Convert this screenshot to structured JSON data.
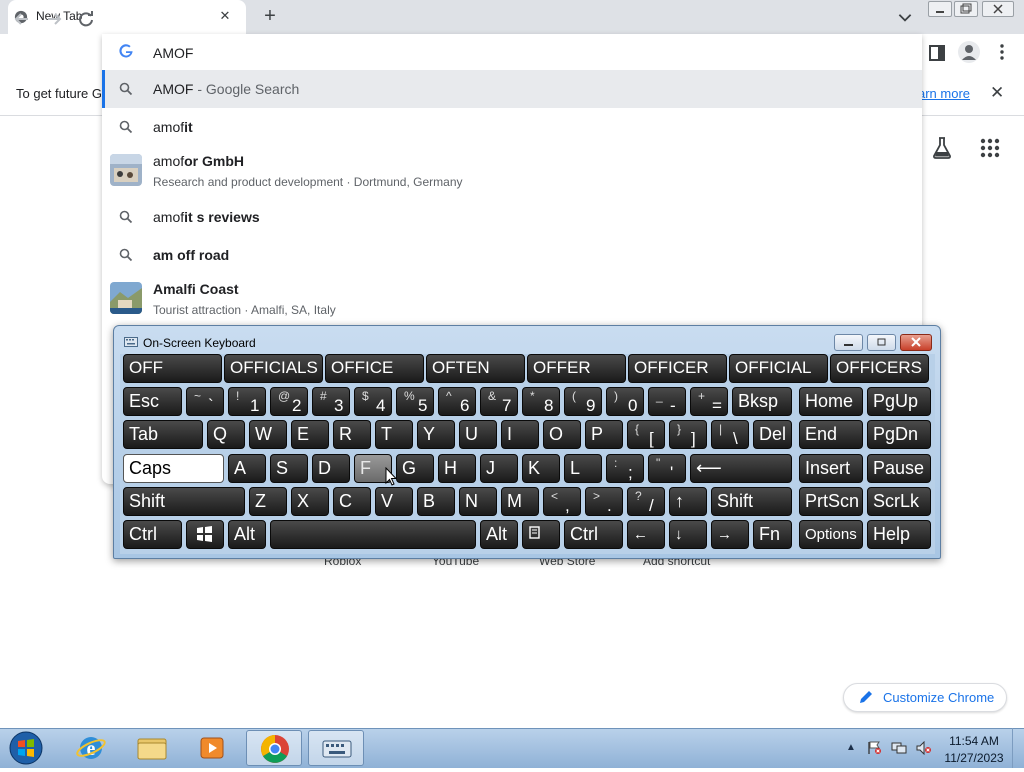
{
  "browser": {
    "tab_title": "New Tab",
    "tab_close_glyph": "✕",
    "new_tab_glyph": "+",
    "omnibox_value": "AMOF",
    "infobar_text": "To get future G",
    "infobar_link": "arn more",
    "infobar_close": "✕"
  },
  "suggestions": [
    {
      "type": "search",
      "icon": "search-icon",
      "prefix": "AMOF",
      "bold": "",
      "suffix": " - Google Search",
      "selected": true
    },
    {
      "type": "search",
      "icon": "search-icon",
      "prefix": "amof",
      "bold": "it",
      "suffix": "",
      "selected": false
    },
    {
      "type": "entity",
      "icon": "entity-thumbnail",
      "prefix": "amof",
      "bold": "or GmbH",
      "suffix": "",
      "sub": "Research and product development · Dortmund, Germany",
      "selected": false
    },
    {
      "type": "search",
      "icon": "search-icon",
      "prefix": "amof",
      "bold": "it s reviews",
      "suffix": "",
      "selected": false
    },
    {
      "type": "search",
      "icon": "search-icon",
      "prefix": "",
      "bold": "am off road",
      "suffix": "",
      "selected": false
    },
    {
      "type": "entity",
      "icon": "entity-thumbnail",
      "prefix": "",
      "bold": "Amalfi Coast",
      "suffix": "",
      "sub": "Tourist attraction · Amalfi, SA, Italy",
      "selected": false
    }
  ],
  "ntp": {
    "shortcuts": [
      "Roblox",
      "YouTube",
      "Web Store",
      "Add shortcut"
    ],
    "customize_label": "Customize Chrome"
  },
  "osk": {
    "title": "On-Screen Keyboard",
    "prediction_row": [
      "OFF",
      "OFFICIALS",
      "OFFICE",
      "OFTEN",
      "OFFER",
      "OFFICER",
      "OFFICIAL",
      "OFFICERS"
    ],
    "keys": {
      "esc": "Esc",
      "tab": "Tab",
      "caps": "Caps",
      "shift_l": "Shift",
      "shift_r": "Shift",
      "ctrl_l": "Ctrl",
      "ctrl_r": "Ctrl",
      "alt_l": "Alt",
      "alt_r": "Alt",
      "bksp": "Bksp",
      "del": "Del",
      "home": "Home",
      "pgup": "PgUp",
      "end": "End",
      "pgdn": "PgDn",
      "insert": "Insert",
      "pause": "Pause",
      "prtscn": "PrtScn",
      "scrlk": "ScrLk",
      "fn": "Fn",
      "options": "Options",
      "help": "Help",
      "enter": "⟵",
      "up": "↑",
      "left": "←",
      "down": "↓",
      "right": "→",
      "q": "Q",
      "w": "W",
      "e": "E",
      "r": "R",
      "t": "T",
      "y": "Y",
      "u": "U",
      "i": "I",
      "o": "O",
      "p": "P",
      "a": "A",
      "s": "S",
      "d": "D",
      "f": "F",
      "g": "G",
      "h": "H",
      "j": "J",
      "k": "K",
      "l": "L",
      "z": "Z",
      "x": "X",
      "c": "C",
      "v": "V",
      "b": "B",
      "n": "N",
      "m": "M"
    },
    "number_row": [
      {
        "top": "~",
        "bot": "`"
      },
      {
        "top": "!",
        "bot": "1"
      },
      {
        "top": "@",
        "bot": "2"
      },
      {
        "top": "#",
        "bot": "3"
      },
      {
        "top": "$",
        "bot": "4"
      },
      {
        "top": "%",
        "bot": "5"
      },
      {
        "top": "^",
        "bot": "6"
      },
      {
        "top": "&",
        "bot": "7"
      },
      {
        "top": "*",
        "bot": "8"
      },
      {
        "top": "(",
        "bot": "9"
      },
      {
        "top": ")",
        "bot": "0"
      },
      {
        "top": "_",
        "bot": "-"
      },
      {
        "top": "+",
        "bot": "="
      }
    ],
    "punct": {
      "lbrace": {
        "top": "{",
        "bot": "["
      },
      "rbrace": {
        "top": "}",
        "bot": "]"
      },
      "pipe": {
        "top": "|",
        "bot": "\\"
      },
      "colon": {
        "top": ":",
        "bot": ";"
      },
      "quote": {
        "top": "\"",
        "bot": "'"
      },
      "lt": {
        "top": "<",
        "bot": ","
      },
      "gt": {
        "top": ">",
        "bot": "."
      },
      "qmark": {
        "top": "?",
        "bot": "/"
      }
    },
    "hovered_key": "F",
    "active_key": "Caps"
  },
  "taskbar": {
    "time": "11:54 AM",
    "date": "11/27/2023",
    "tray_arrow": "▲"
  },
  "colors": {
    "accent": "#1a73e8",
    "osk_key": "#1a1a1a",
    "taskbar": "#a4c2e0"
  }
}
